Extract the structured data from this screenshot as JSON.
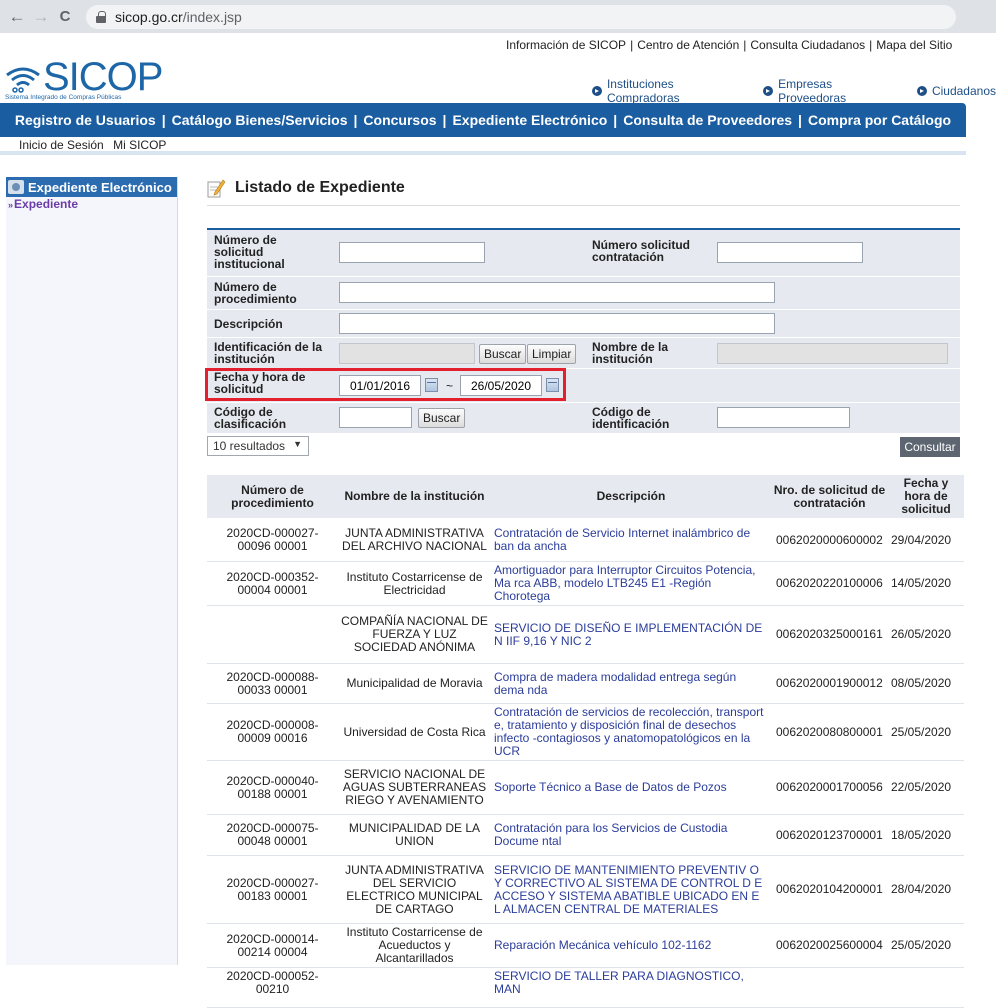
{
  "browser": {
    "back": "←",
    "forward": "→",
    "reload": "C",
    "url_host": "sicop.go.cr",
    "url_path": "/index.jsp"
  },
  "header": {
    "top_links": [
      "Información de SICOP",
      "Centro de Atención",
      "Consulta Ciudadanos",
      "Mapa del Sitio"
    ],
    "logo_text": "SICOP",
    "logo_sub": "Sistema Integrado de Compras Públicas",
    "roles": [
      "Instituciones Compradoras",
      "Empresas Proveedoras",
      "Ciudadanos"
    ],
    "main_nav": [
      "Registro de Usuarios",
      "Catálogo Bienes/Servicios",
      "Concursos",
      "Expediente Electrónico",
      "Consulta de Proveedores",
      "Compra por Catálogo"
    ],
    "sub_nav": [
      "Inicio de Sesión",
      "Mi SICOP"
    ]
  },
  "sidebar": {
    "title": "Expediente Electrónico",
    "items": [
      {
        "label": "Expediente"
      }
    ]
  },
  "page": {
    "title": "Listado de Expediente"
  },
  "form": {
    "num_solicitud_institucional": {
      "label": "Número de solicitud institucional",
      "value": ""
    },
    "num_solicitud_contratacion": {
      "label": "Número solicitud contratación",
      "value": ""
    },
    "num_procedimiento": {
      "label": "Número de procedimiento",
      "value": ""
    },
    "descripcion": {
      "label": "Descripción",
      "value": ""
    },
    "identificacion": {
      "label": "Identificación de la institución",
      "value": ""
    },
    "nombre_institucion": {
      "label": "Nombre de la institución",
      "value": ""
    },
    "fecha": {
      "label": "Fecha y hora de solicitud",
      "from": "01/01/2016",
      "sep": "~",
      "to": "26/05/2020"
    },
    "codigo_clasificacion": {
      "label": "Código de clasificación",
      "value": ""
    },
    "codigo_identificacion": {
      "label": "Código de identificación",
      "value": ""
    },
    "buscar_label": "Buscar",
    "limpiar_label": "Limpiar",
    "results_select": "10 resultados",
    "consultar_label": "Consultar"
  },
  "table": {
    "headers": [
      "Número de procedimiento",
      "Nombre de la institución",
      "Descripción",
      "Nro. de solicitud de contratación",
      "Fecha y hora de solicitud"
    ],
    "rows": [
      {
        "proc": "2020CD-000027-00096 00001",
        "inst": "JUNTA ADMINISTRATIVA DEL ARCHIVO NACIONAL",
        "desc": "Contratación de Servicio Internet inalámbrico de ban da ancha",
        "nro": "0062020000600002",
        "fecha": "29/04/2020"
      },
      {
        "proc": "2020CD-000352-00004 00001",
        "inst": "Instituto Costarricense de Electricidad",
        "desc": "Amortiguador para Interruptor Circuitos Potencia, Ma rca ABB, modelo LTB245 E1 -Región Chorotega",
        "nro": "0062020220100006",
        "fecha": "14/05/2020"
      },
      {
        "proc": "",
        "inst": "COMPAÑÍA NACIONAL DE FUERZA Y LUZ SOCIEDAD ANÓNIMA",
        "desc": "SERVICIO DE DISEÑO E IMPLEMENTACIÓN DE N IIF 9,16 Y NIC 2",
        "nro": "0062020325000161",
        "fecha": "26/05/2020"
      },
      {
        "proc": "2020CD-000088-00033 00001",
        "inst": "Municipalidad de Moravia",
        "desc": "Compra de madera modalidad entrega según dema nda",
        "nro": "0062020001900012",
        "fecha": "08/05/2020"
      },
      {
        "proc": "2020CD-000008-00009 00016",
        "inst": "Universidad de Costa Rica",
        "desc": "Contratación de servicios de recolección, transport e, tratamiento y disposición final de desechos infecto -contagiosos y anatomopatológicos en la UCR",
        "nro": "0062020080800001",
        "fecha": "25/05/2020"
      },
      {
        "proc": "2020CD-000040-00188 00001",
        "inst": "SERVICIO NACIONAL DE AGUAS SUBTERRANEAS RIEGO Y AVENAMIENTO",
        "desc": "Soporte Técnico a Base de Datos de Pozos",
        "nro": "0062020001700056",
        "fecha": "22/05/2020"
      },
      {
        "proc": "2020CD-000075-00048 00001",
        "inst": "MUNICIPALIDAD DE LA UNION",
        "desc": "Contratación para los Servicios de Custodia Docume ntal",
        "nro": "0062020123700001",
        "fecha": "18/05/2020"
      },
      {
        "proc": "2020CD-000027-00183 00001",
        "inst": "JUNTA ADMINISTRATIVA DEL SERVICIO ELECTRICO MUNICIPAL DE CARTAGO",
        "desc": "SERVICIO DE MANTENIMIENTO PREVENTIV O Y CORRECTIVO AL SISTEMA DE CONTROL D E ACCESO Y SISTEMA ABATIBLE UBICADO EN E L ALMACEN CENTRAL DE MATERIALES",
        "nro": "0062020104200001",
        "fecha": "28/04/2020"
      },
      {
        "proc": "2020CD-000014-00214 00004",
        "inst": "Instituto Costarricense de Acueductos y Alcantarillados",
        "desc": "Reparación Mecánica vehículo 102-1162",
        "nro": "0062020025600004",
        "fecha": "25/05/2020"
      },
      {
        "proc": "2020CD-000052-00210",
        "inst": "",
        "desc": "SERVICIO DE TALLER PARA DIAGNOSTICO, MAN",
        "nro": "",
        "fecha": ""
      }
    ]
  }
}
